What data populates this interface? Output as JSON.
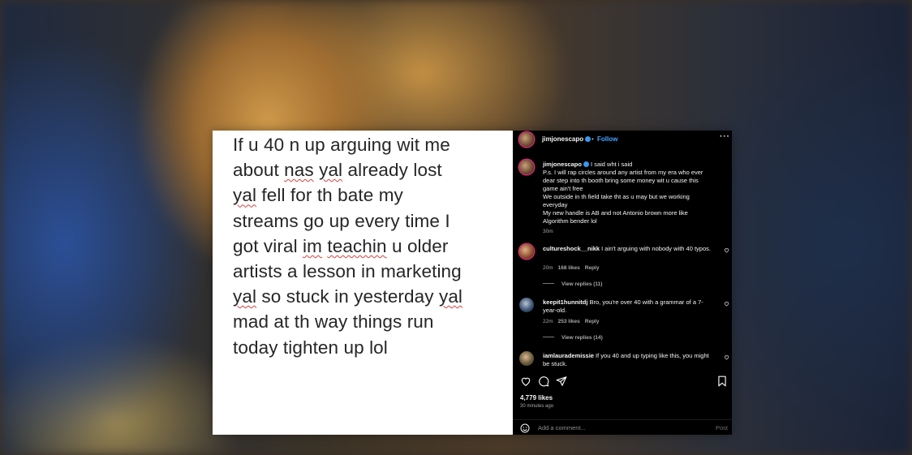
{
  "post_image": {
    "lines": [
      [
        {
          "t": "If u 40 n up arguing wit me"
        }
      ],
      [
        {
          "t": "about "
        },
        {
          "t": "nas",
          "sq": true
        },
        {
          "t": " "
        },
        {
          "t": "yal",
          "sq": true
        },
        {
          "t": " already lost"
        }
      ],
      [
        {
          "t": "yal",
          "sq": true
        },
        {
          "t": " fell for th bate my"
        }
      ],
      [
        {
          "t": "streams go up every time I"
        }
      ],
      [
        {
          "t": "got viral "
        },
        {
          "t": "im",
          "sq": true
        },
        {
          "t": " "
        },
        {
          "t": "teachin",
          "sq": true
        },
        {
          "t": " u older"
        }
      ],
      [
        {
          "t": "artists a lesson in marketing"
        }
      ],
      [
        {
          "t": "yal",
          "sq": true
        },
        {
          "t": " so stuck in yesterday "
        },
        {
          "t": "yal",
          "sq": true
        }
      ],
      [
        {
          "t": "mad at th way things run"
        }
      ],
      [
        {
          "t": "today tighten up lol"
        }
      ]
    ]
  },
  "header": {
    "username": "jimjonescapo",
    "separator": "•",
    "follow_label": "Follow",
    "more_label": "···"
  },
  "caption": {
    "username": "jimjonescapo",
    "first_line": "I said wht i said",
    "body_lines": [
      "P.s. I will rap circles around any artist from my era who ever",
      "dear step into th booth bring some money wit u cause this",
      "game ain't free",
      "We outside in th field take tht as u may but we working",
      "everyday",
      "My new handle is AB and not Antonio brown more like",
      "Algorithm bender lol"
    ],
    "time": "30m"
  },
  "comments": [
    {
      "username": "cultureshock__nikk",
      "text": "I ain't arguing with nobody with 40 typos.",
      "time": "20m",
      "likes": "168 likes",
      "reply_label": "Reply",
      "view_replies": "View replies (11)"
    },
    {
      "username": "keepit1hunnitdj",
      "text": "Bro, you're over 40 with a grammar of a 7-year-old.",
      "time": "22m",
      "likes": "253 likes",
      "reply_label": "Reply",
      "view_replies": "View replies (14)"
    },
    {
      "username": "iamlaurademissie",
      "text": "If you 40 and up typing like this, you might be stuck."
    }
  ],
  "stats": {
    "likes": "4,779 likes",
    "posted_ago": "30 minutes ago"
  },
  "add_comment": {
    "placeholder": "Add a comment...",
    "post_label": "Post"
  },
  "colors": {
    "panel_bg": "#000000",
    "follow_blue": "#4aa3ff",
    "verified_blue": "#3897f0",
    "image_bg": "#ffffff",
    "text_dark": "#262626"
  },
  "icons": [
    "heart-icon",
    "comment-icon",
    "share-icon",
    "bookmark-icon",
    "emoji-icon",
    "verified-badge-icon",
    "more-options-icon"
  ]
}
